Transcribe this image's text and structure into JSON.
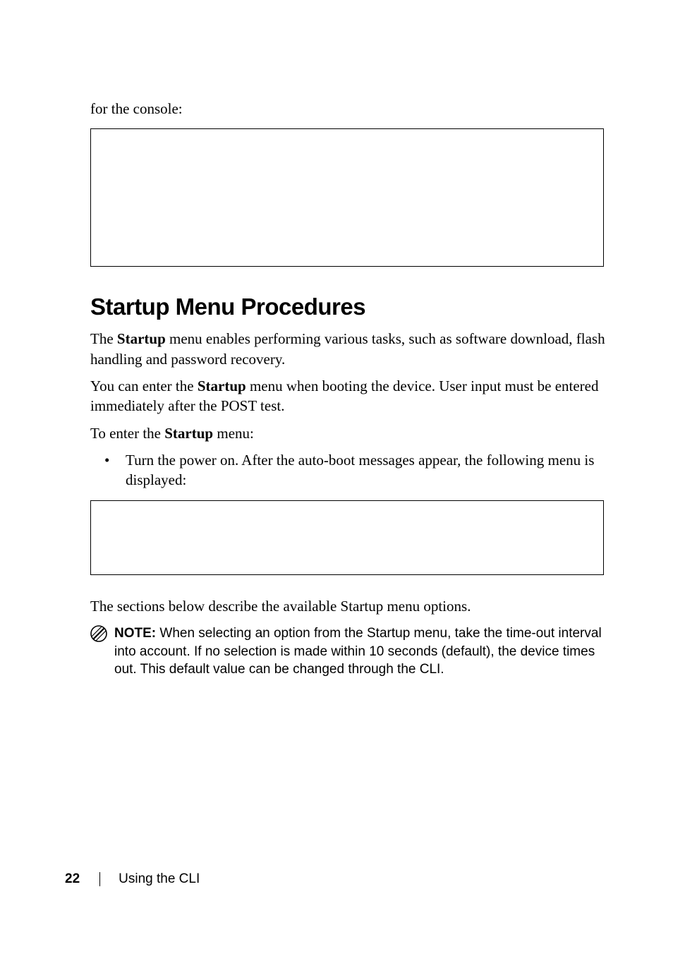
{
  "intro_text": "for the console:",
  "heading": "Startup Menu Procedures",
  "paragraphs": {
    "p1a": "The ",
    "p1b": "Startup",
    "p1c": " menu enables performing various tasks, such as software download, flash handling and password recovery.",
    "p2a": "You can enter the ",
    "p2b": "Startup",
    "p2c": " menu when booting the device. User input must be entered immediately after the POST test.",
    "p3a": "To enter the ",
    "p3b": "Startup",
    "p3c": " menu:",
    "bullet": "Turn the power on. After the auto-boot messages appear, the following menu is displayed:",
    "p4": "The sections below describe the available Startup menu options."
  },
  "note": {
    "label": "NOTE:",
    "text": " When selecting an option from the Startup menu, take the time-out interval into account. If no selection is made within 10 seconds (default), the device times out. This default value can be changed through the CLI."
  },
  "footer": {
    "page": "22",
    "section": "Using the CLI"
  }
}
